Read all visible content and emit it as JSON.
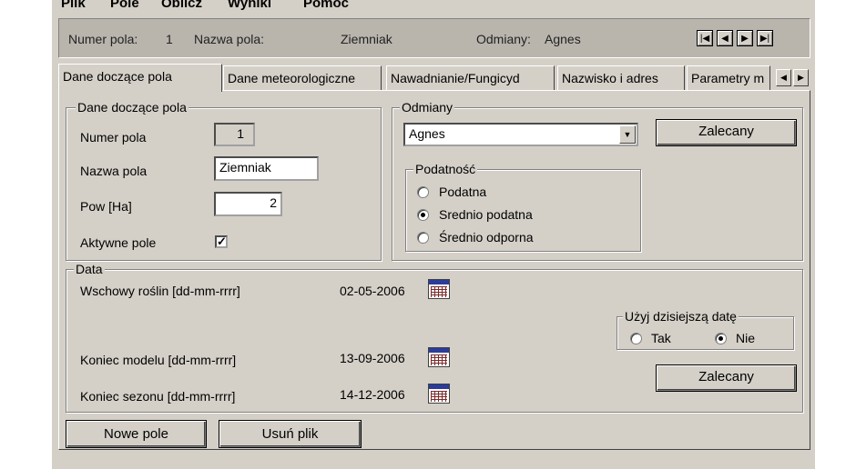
{
  "menu": [
    "Plik",
    "Pole",
    "Oblicz",
    "Wyniki",
    "Pomoc"
  ],
  "infobar": {
    "numer_label": "Numer pola:",
    "numer_value": "1",
    "nazwa_label": "Nazwa pola:",
    "nazwa_value": "Ziemniak",
    "odmiany_label": "Odmiany:",
    "odmiany_value": "Agnes"
  },
  "tabs": [
    "Dane doczące pola",
    "Dane meteorologiczne",
    "Nawadnianie/Fungicyd",
    "Nazwisko i adres",
    "Parametry m"
  ],
  "dane": {
    "legend": "Dane doczące pola",
    "numer_label": "Numer pola",
    "numer_value": "1",
    "nazwa_label": "Nazwa pola",
    "nazwa_value": "Ziemniak",
    "pow_label": "Pow [Ha]",
    "pow_value": "2",
    "aktywne_label": "Aktywne pole",
    "aktywne_checked": true
  },
  "odmiany": {
    "legend": "Odmiany",
    "selected": "Agnes",
    "zalecany": "Zalecany",
    "podatnosc": {
      "legend": "Podatność",
      "options": [
        "Podatna",
        "Srednio podatna",
        "Średnio odporna"
      ],
      "selected_index": 1
    }
  },
  "data": {
    "legend": "Data",
    "wschody_label": "Wschowy roślin [dd-mm-rrrr]",
    "wschody_value": "02-05-2006",
    "koniec_modelu_label": "Koniec modelu [dd-mm-rrrr]",
    "koniec_modelu_value": "13-09-2006",
    "koniec_sezonu_label": "Koniec sezonu [dd-mm-rrrr]",
    "koniec_sezonu_value": "14-12-2006",
    "dzisiaj": {
      "legend": "Użyj dzisiejszą datę",
      "tak": "Tak",
      "nie": "Nie",
      "selected": "Nie"
    },
    "zalecany": "Zalecany"
  },
  "buttons": {
    "nowe_pole": "Nowe pole",
    "usun_plik": "Usuń plik"
  },
  "colors": {
    "window": "#d4d0c8",
    "infobar": "#b9b5ad"
  }
}
